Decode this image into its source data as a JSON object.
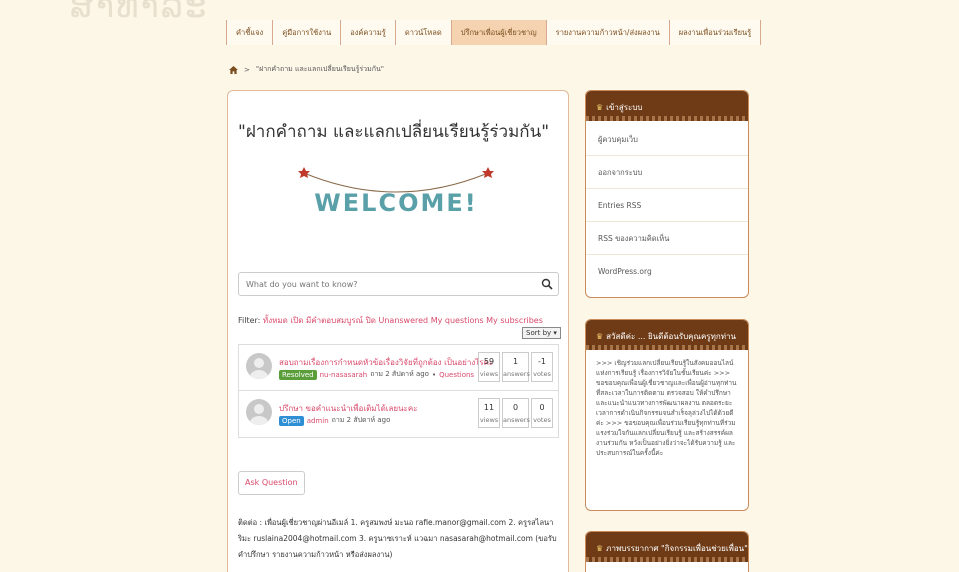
{
  "watermark": "ສາທາລະ",
  "nav": [
    {
      "label": "คำชี้แจง",
      "active": false
    },
    {
      "label": "คู่มือการใช้งาน",
      "active": false
    },
    {
      "label": "องค์ความรู้",
      "active": false
    },
    {
      "label": "ดาวน์โหลด",
      "active": false
    },
    {
      "label": "ปรึกษาเพื่อนผู้เชี่ยวชาญ",
      "active": true
    },
    {
      "label": "รายงานความก้าวหน้า/ส่งผลงาน",
      "active": false
    },
    {
      "label": "ผลงานเพื่อนร่วมเรียนรู้",
      "active": false
    }
  ],
  "breadcrumb": {
    "separator": ">",
    "current": "\"ฝากคำถาม และแลกเปลี่ยนเรียนรู้ร่วมกัน\""
  },
  "main": {
    "title": "\"ฝากคำถาม และแลกเปลี่ยนเรียนรู้ร่วมกัน\"",
    "welcome_text": "WELCOME!",
    "search": {
      "placeholder": "What do you want to know?"
    },
    "filter": {
      "label": "Filter:",
      "items": [
        "ทั้งหมด",
        "เปิด",
        "มีคำตอบสมบูรณ์",
        "ปิด",
        "Unanswered",
        "My questions",
        "My subscribes"
      ]
    },
    "sort_label": "Sort by",
    "questions": [
      {
        "title": "สอบถามเรื่องการกำหนดหัวข้อเรื่องวิจัยที่ถูกต้อง เป็นอย่างไรคะ",
        "status": "Resolved",
        "status_type": "resolved",
        "author": "nu-nasasarah",
        "asked": "ถาม 2 สัปดาห์ ago",
        "bullet": "•",
        "category": "Questions",
        "views": "59",
        "answers": "1",
        "votes": "-1"
      },
      {
        "title": "ปรึกษา ขอคำแนะนำเพื่อเติมได้เลยนะคะ",
        "status": "Open",
        "status_type": "open",
        "author": "admin",
        "asked": "ถาม 2 สัปดาห์ ago",
        "bullet": "",
        "category": "",
        "views": "11",
        "answers": "0",
        "votes": "0"
      }
    ],
    "stat_labels": {
      "views": "views",
      "answers": "answers",
      "votes": "votes"
    },
    "ask_button": "Ask Question",
    "contact_text": "ติดต่อ : เพื่อนผู้เชี่ยวชาญผ่านอีเมล์ 1. ครูสมพงษ์ มะนอ rafie.manor@gmail.com 2. ครูรสไลนา ริมะ ruslaina2004@hotmail.com 3. ครูนาซเราะห์ แวฉมา nasasarah@hotmail.com (ขอรับคำปรึกษา รายงานความก้าวหน้า หรือส่งผลงาน)"
  },
  "sidebar": {
    "login": {
      "title": "เข้าสู่ระบบ",
      "links": [
        "ผู้ควบคุมเว็บ",
        "ออกจากระบบ",
        "Entries RSS",
        "RSS ของความคิดเห็น",
        "WordPress.org"
      ]
    },
    "welcome": {
      "title": "สวัสดีค่ะ ... ยินดีต้อนรับคุณครูทุกท่าน",
      "text": ">>> เชิญร่วมแลกเปลี่ยนเรียนรู้ในสังคมออนไลน์ แห่งการเรียนรู้ เรื่องการวิจัยในชั้นเรียนค่ะ >>> ขอขอบคุณเพื่อนผู้เชี่ยวชาญและเพื่อนผู้อ่านทุกท่าน ที่สละเวลาในการติดตาม ตรวจสอบ ให้คำปรึกษา และแนะนำแนวทางการพัฒนาผลงาน ตลอดระยะเวลาการดำเนินกิจกรรมจนสำเร็จลุล่วงไปได้ด้วยดีค่ะ >>> ขอขอบคุณเพื่อนร่วมเรียนรู้ทุกท่านที่ร่วมแรงร่วมใจกันแลกเปลี่ยนเรียนรู้ และสร้างสรรค์ผลงานร่วมกัน หวังเป็นอย่างยิ่งว่าจะได้รับความรู้ และประสบการณ์ในครั้งนี้ค่ะ"
    },
    "gallery": {
      "title": "ภาพบรรยากาศ \"กิจกรรมเพื่อนช่วยเพื่อน\""
    }
  },
  "colors": {
    "accent": "#d94a6b",
    "header_brown": "#6e3b16",
    "background": "#fdf7e8"
  }
}
